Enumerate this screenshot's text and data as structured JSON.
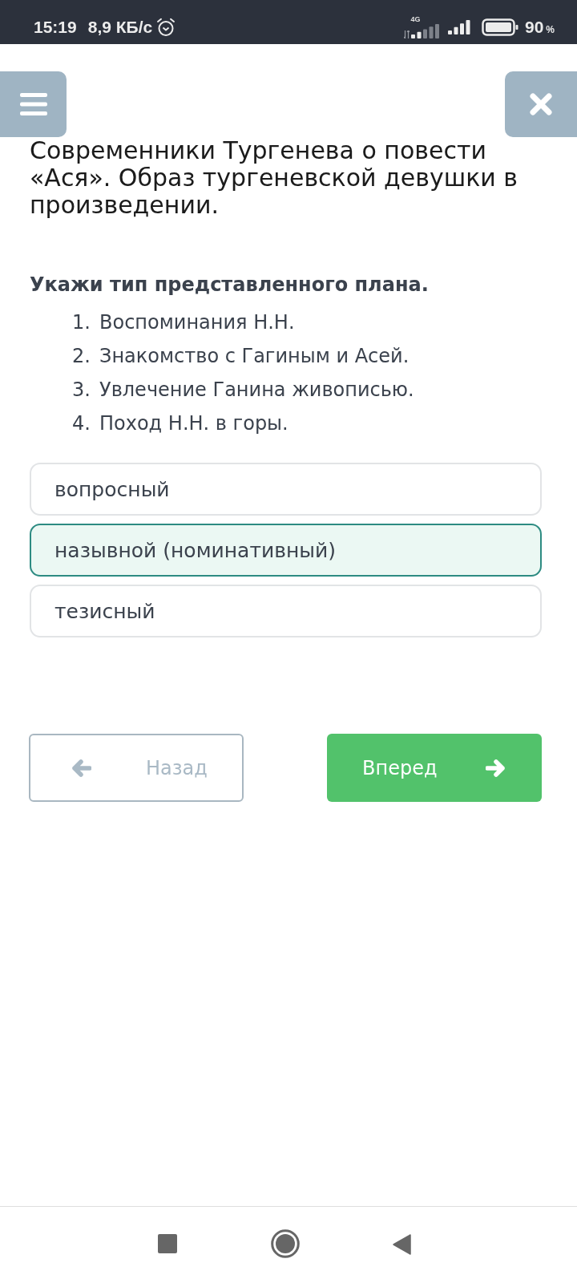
{
  "status_bar": {
    "time": "15:19",
    "speed": "8,9 КБ/с",
    "network_type": "4G",
    "battery": "90",
    "battery_unit": "%"
  },
  "title": "Современники Тургенева о повести «Ася». Образ тургеневской девушки в произведении.",
  "question": {
    "prompt": "Укажи тип представленного плана.",
    "plan": [
      {
        "number": "1.",
        "text": "Воспоминания Н.Н."
      },
      {
        "number": "2.",
        "text": "Знакомство с Гагиным и Асей."
      },
      {
        "number": "3.",
        "text": "Увлечение Ганина живописью."
      },
      {
        "number": "4.",
        "text": "Поход Н.Н. в горы."
      }
    ]
  },
  "options": [
    {
      "label": "вопросный",
      "selected": false
    },
    {
      "label": "назывной (номинативный)",
      "selected": true
    },
    {
      "label": "тезисный",
      "selected": false
    }
  ],
  "navigation": {
    "back": {
      "label": "Назад",
      "disabled": true
    },
    "forward": {
      "label": "Вперед",
      "disabled": false
    }
  }
}
